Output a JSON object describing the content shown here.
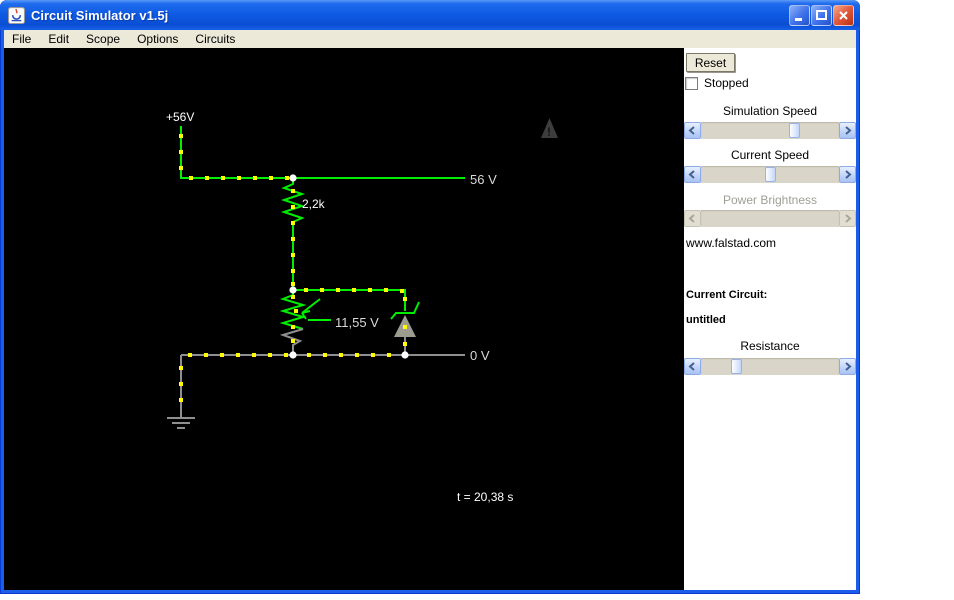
{
  "window": {
    "title": "Circuit Simulator v1.5j"
  },
  "menu": {
    "items": [
      "File",
      "Edit",
      "Scope",
      "Options",
      "Circuits"
    ]
  },
  "sidebar": {
    "reset_button": "Reset",
    "stopped": {
      "label": "Stopped",
      "checked": false
    },
    "sliders": {
      "simulation_speed": {
        "label": "Simulation Speed",
        "thumb": 0.69,
        "enabled": true
      },
      "current_speed": {
        "label": "Current Speed",
        "thumb": 0.5,
        "enabled": true
      },
      "power_brightness": {
        "label": "Power Brightness",
        "thumb": null,
        "enabled": false
      },
      "resistance": {
        "label": "Resistance",
        "thumb": 0.24,
        "enabled": true
      }
    },
    "website": "www.falstad.com",
    "current_circuit_label": "Current Circuit:",
    "current_circuit_name": "untitled"
  },
  "circuit": {
    "labels": {
      "supply": "+56V",
      "resistor": "2,2k",
      "wiper_voltage": "11,55 V",
      "top_rail": "56 V",
      "bottom_rail": "0 V",
      "time": "t = 20,38 s",
      "warning": "!"
    },
    "colors": {
      "wire_positive": "#00ef00",
      "wire_ground": "#8f8f8f",
      "current_dot": "#ffff00",
      "junction": "#ffffff",
      "label_text": "#d9d9d9",
      "canvas_bg": "#000000",
      "titlebar_blue": "#0f5be4",
      "menubar_bg": "#ece9d8"
    }
  }
}
